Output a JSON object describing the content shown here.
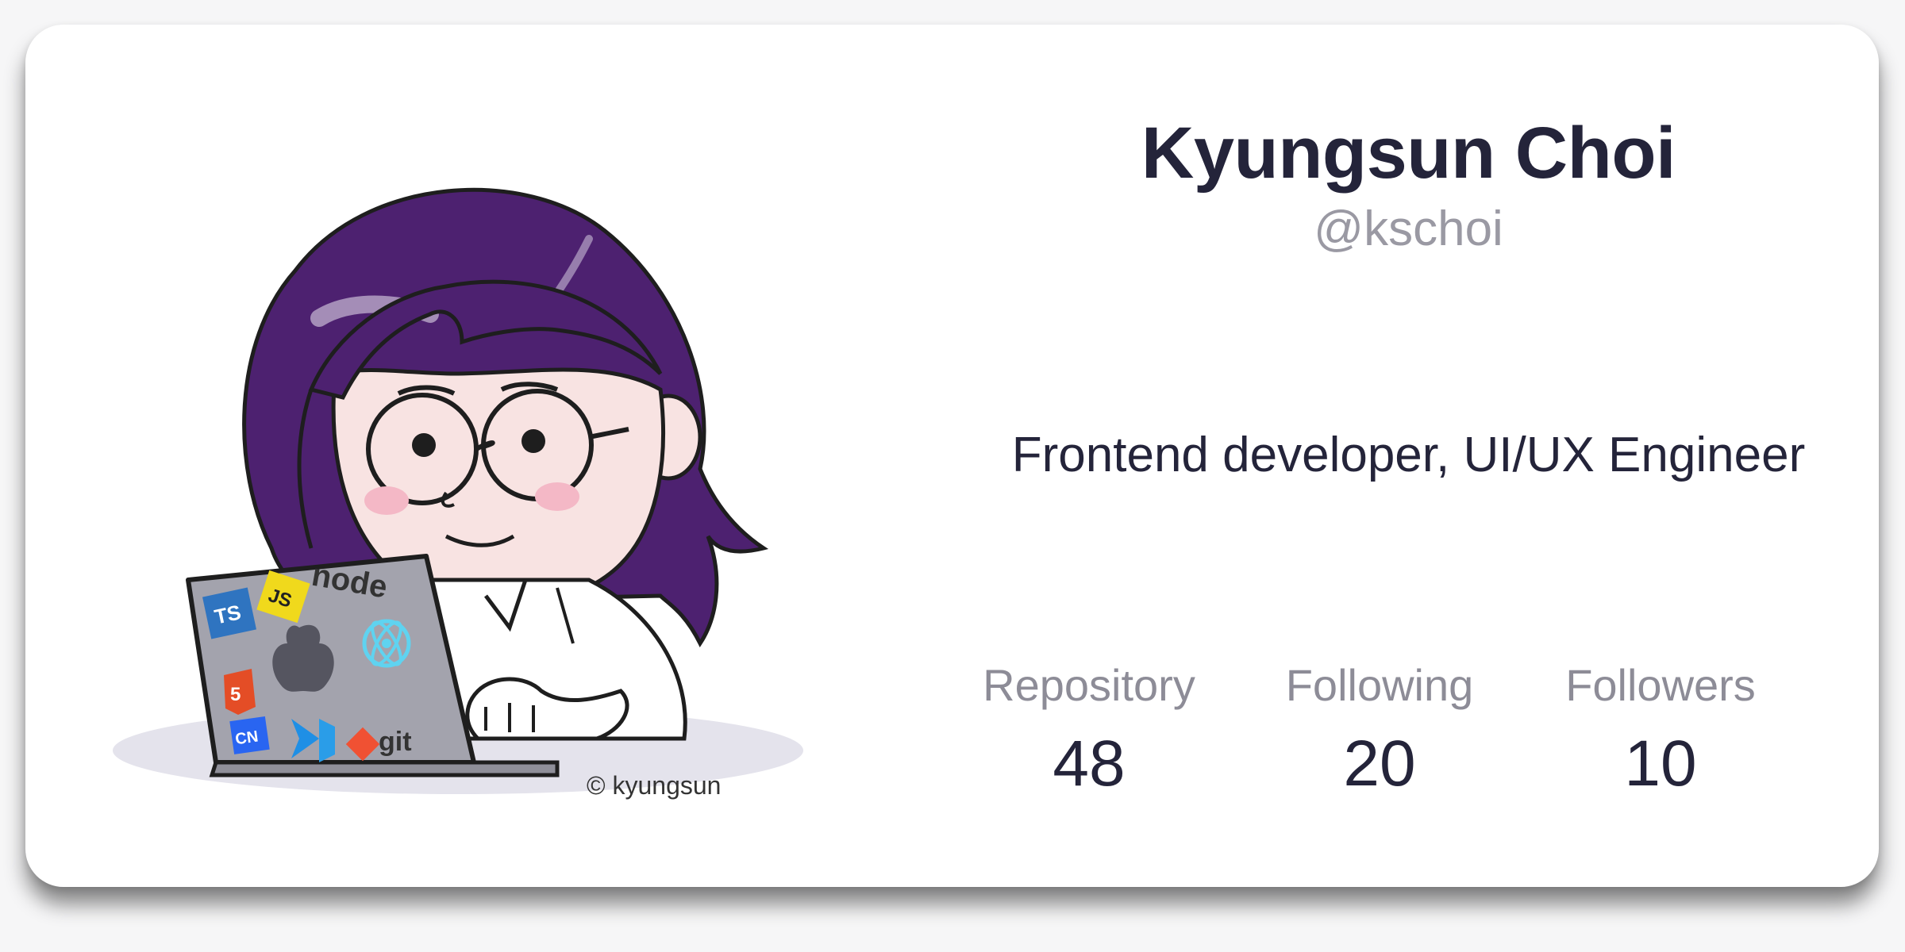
{
  "profile": {
    "name": "Kyungsun Choi",
    "handle": "@kschoi",
    "bio": "Frontend developer, UI/UX Engineer",
    "avatar_icon": "developer-avatar-illustration",
    "avatar_watermark": "© kyungsun",
    "laptop_stickers": [
      "TS",
      "JS",
      "node",
      "HTML",
      "CSS",
      "git"
    ]
  },
  "stats": [
    {
      "label": "Repository",
      "value": "48"
    },
    {
      "label": "Following",
      "value": "20"
    },
    {
      "label": "Followers",
      "value": "10"
    }
  ],
  "colors": {
    "text_primary": "#24243a",
    "text_muted": "#9a99a3",
    "hair": "#4d2170",
    "laptop": "#a3a3ad",
    "card_bg": "#ffffff"
  }
}
